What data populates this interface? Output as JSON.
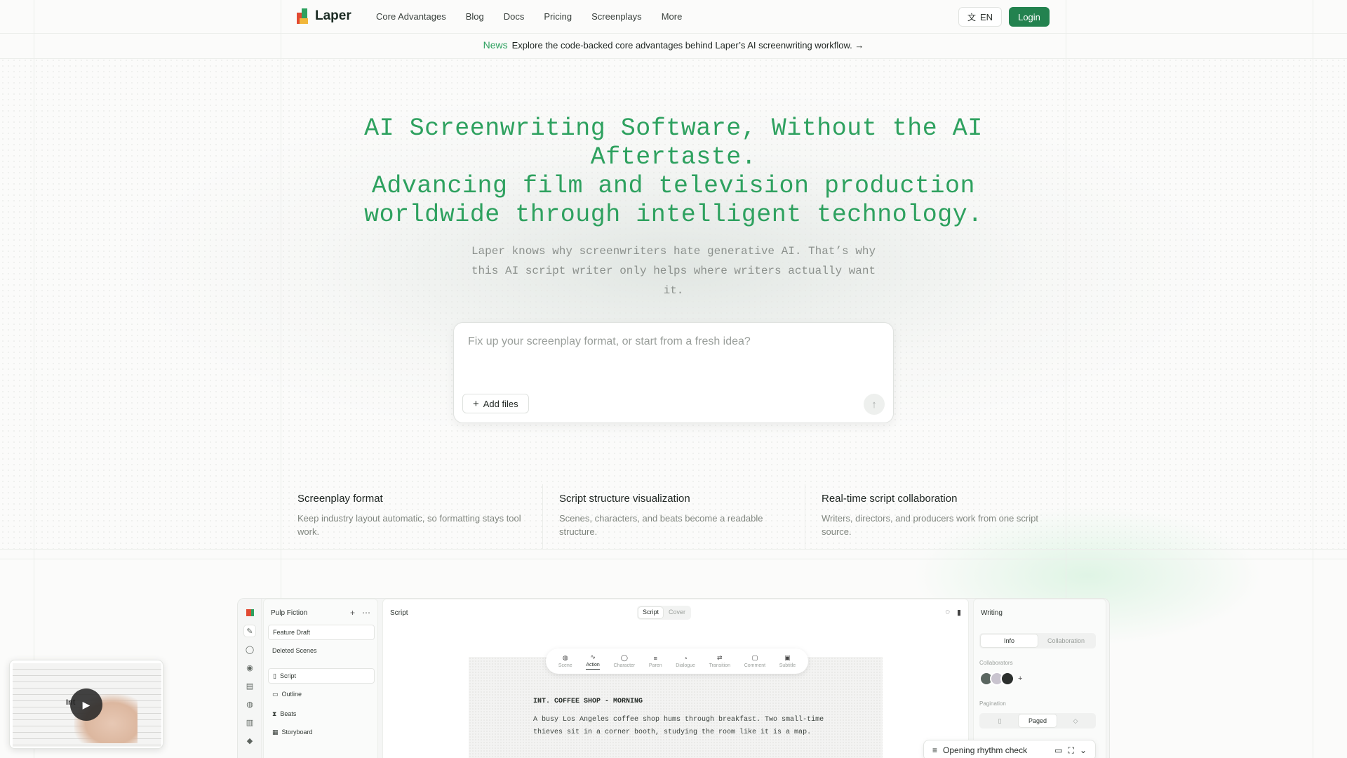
{
  "brand": {
    "name": "Laper"
  },
  "nav": {
    "links": [
      "Core Advantages",
      "Blog",
      "Docs",
      "Pricing",
      "Screenplays",
      "More"
    ],
    "lang": "EN",
    "login": "Login"
  },
  "news": {
    "tag": "News",
    "text": "Explore the code-backed core advantages behind Laper’s AI screenwriting workflow.",
    "arrow": "→"
  },
  "hero": {
    "title_line1": "AI Screenwriting Software, Without the AI Aftertaste.",
    "title_line2": "Advancing film and television production worldwide through intelligent technology.",
    "subtitle": "Laper knows why screenwriters hate generative AI. That’s why this AI script writer only helps where writers actually want it."
  },
  "prompt": {
    "placeholder": "Fix up your screenplay format, or start from a fresh idea?",
    "add_files": "Add files",
    "send_icon": "arrow-up-icon"
  },
  "features": [
    {
      "title": "Screenplay format",
      "desc": "Keep industry layout automatic, so formatting stays tool work."
    },
    {
      "title": "Script structure visualization",
      "desc": "Scenes, characters, and beats become a readable structure."
    },
    {
      "title": "Real-time script collaboration",
      "desc": "Writers, directors, and producers work from one script source."
    }
  ],
  "app": {
    "project": "Pulp Fiction",
    "left_items": [
      "Feature Draft",
      "Deleted Scenes"
    ],
    "nav_items": [
      "Script",
      "Outline",
      "Beats",
      "Storyboard"
    ],
    "center_title": "Script",
    "seg": [
      "Script",
      "Cover"
    ],
    "toolbar": [
      "Scene",
      "Action",
      "Character",
      "Paren",
      "Dialogue",
      "Transition",
      "Comment",
      "Subtitle"
    ],
    "scene_heading": "INT. COFFEE SHOP - MORNING",
    "action": "A busy Los Angeles coffee shop hums through breakfast. Two small-time thieves sit in a corner booth, studying the room like it is a map.",
    "right_title": "Writing",
    "right_tabs": [
      "Info",
      "Collaboration"
    ],
    "collaborators_label": "Collaborators",
    "pagination_label": "Pagination",
    "pagination_on": "Paged",
    "rhythm": "Opening rhythm check"
  },
  "video": {
    "overlay_text": "Int"
  },
  "colors": {
    "accent": "#2ea15f",
    "login_bg": "#23824f"
  }
}
